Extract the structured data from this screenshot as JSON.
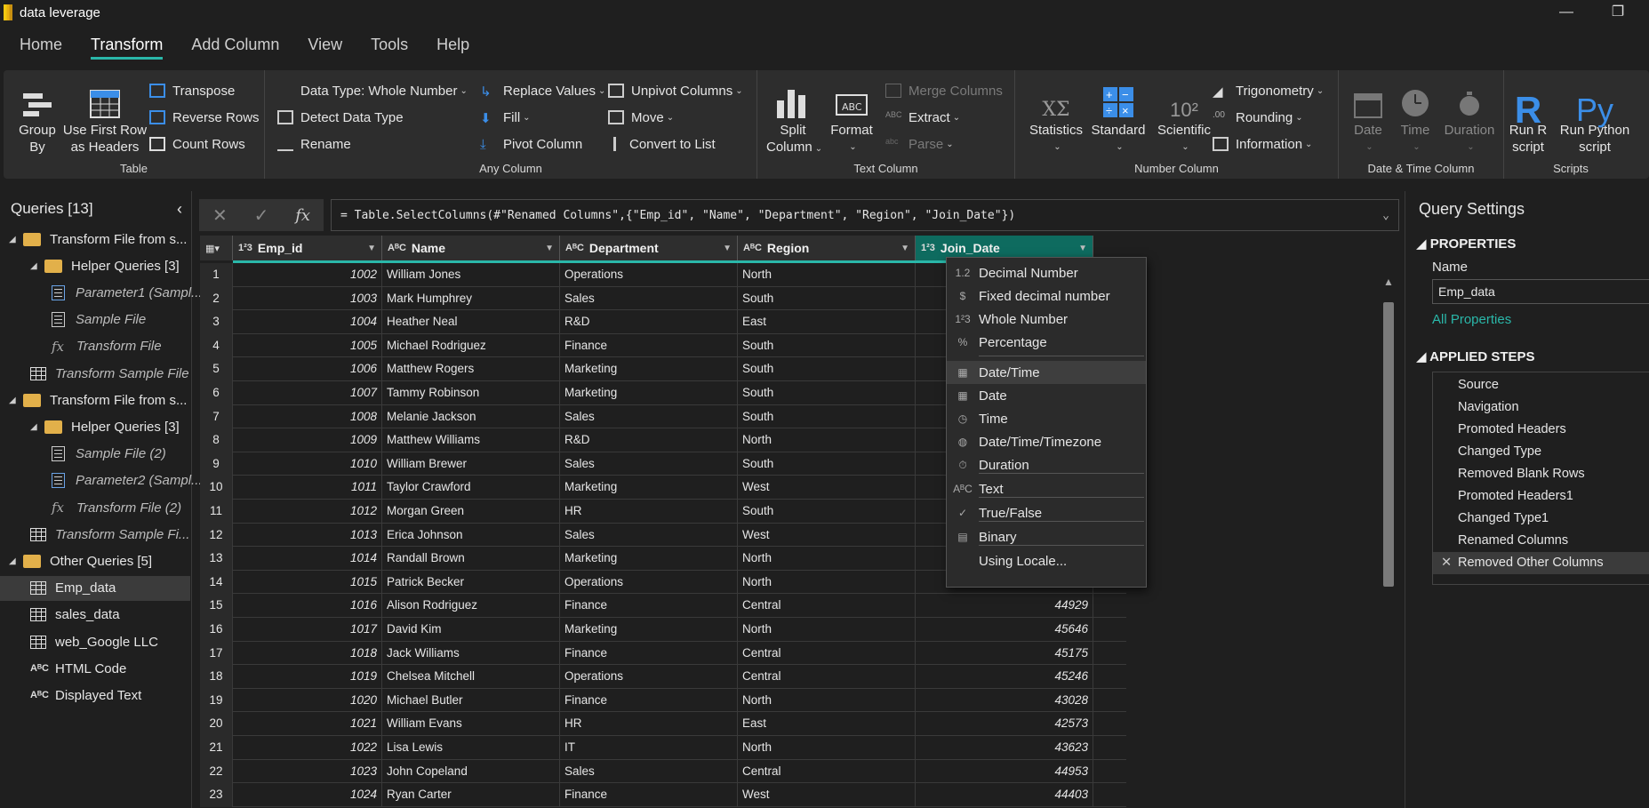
{
  "window": {
    "title": "data leverage",
    "minimize": "—",
    "restore": "❐"
  },
  "menu": {
    "items": [
      "Home",
      "Transform",
      "Add Column",
      "View",
      "Tools",
      "Help"
    ],
    "active": "Transform"
  },
  "ribbon": {
    "table": {
      "label": "Table",
      "group_by": [
        "Group",
        "By"
      ],
      "first_row": [
        "Use First Row",
        "as Headers"
      ],
      "transpose": "Transpose",
      "reverse_rows": "Reverse Rows",
      "count_rows": "Count Rows"
    },
    "any_column": {
      "label": "Any Column",
      "data_type": "Data Type: Whole Number",
      "detect_type": "Detect Data Type",
      "rename": "Rename",
      "replace_values": "Replace Values",
      "fill": "Fill",
      "pivot": "Pivot Column",
      "unpivot": "Unpivot Columns",
      "move": "Move",
      "convert_list": "Convert to List"
    },
    "text_column": {
      "label": "Text Column",
      "split": [
        "Split",
        "Column"
      ],
      "format": "Format",
      "merge": "Merge Columns",
      "extract": "Extract",
      "parse": "Parse"
    },
    "number_column": {
      "label": "Number Column",
      "statistics": "Statistics",
      "standard": "Standard",
      "scientific": "Scientific",
      "trig": "Trigonometry",
      "rounding": "Rounding",
      "information": "Information"
    },
    "datetime_column": {
      "label": "Date & Time Column",
      "date": "Date",
      "time": "Time",
      "duration": "Duration"
    },
    "scripts": {
      "label": "Scripts",
      "r": [
        "Run R",
        "script"
      ],
      "py": [
        "Run Python",
        "script"
      ]
    }
  },
  "queries": {
    "title": "Queries [13]",
    "items": [
      {
        "label": "Transform File from s...",
        "type": "folder",
        "indent": 0
      },
      {
        "label": "Helper Queries [3]",
        "type": "folder",
        "indent": 1
      },
      {
        "label": "Parameter1 (Sampl...",
        "type": "param",
        "indent": 2,
        "italic": true
      },
      {
        "label": "Sample File",
        "type": "doc",
        "indent": 2,
        "italic": true
      },
      {
        "label": "Transform File",
        "type": "fx",
        "indent": 2,
        "italic": true
      },
      {
        "label": "Transform Sample File",
        "type": "table",
        "indent": 1,
        "italic": true
      },
      {
        "label": "Transform File from s...",
        "type": "folder",
        "indent": 0
      },
      {
        "label": "Helper Queries [3]",
        "type": "folder",
        "indent": 1
      },
      {
        "label": "Sample File (2)",
        "type": "doc",
        "indent": 2,
        "italic": true
      },
      {
        "label": "Parameter2 (Sampl...",
        "type": "param",
        "indent": 2,
        "italic": true
      },
      {
        "label": "Transform File (2)",
        "type": "fx",
        "indent": 2,
        "italic": true
      },
      {
        "label": "Transform Sample Fi...",
        "type": "table",
        "indent": 1,
        "italic": true
      },
      {
        "label": "Other Queries [5]",
        "type": "folder",
        "indent": 0
      },
      {
        "label": "Emp_data",
        "type": "table",
        "indent": 1,
        "selected": true
      },
      {
        "label": "sales_data",
        "type": "table",
        "indent": 1
      },
      {
        "label": "web_Google LLC",
        "type": "table",
        "indent": 1
      },
      {
        "label": "HTML Code",
        "type": "abc",
        "indent": 1
      },
      {
        "label": "Displayed Text",
        "type": "abc",
        "indent": 1
      }
    ]
  },
  "formula": {
    "text": "= Table.SelectColumns(#\"Renamed Columns\",{\"Emp_id\", \"Name\", \"Department\", \"Region\", \"Join_Date\"})",
    "fx": "fx"
  },
  "table": {
    "columns": [
      {
        "name": "Emp_id",
        "type": "1²3"
      },
      {
        "name": "Name",
        "type": "AᴮC"
      },
      {
        "name": "Department",
        "type": "AᴮC"
      },
      {
        "name": "Region",
        "type": "AᴮC"
      },
      {
        "name": "Join_Date",
        "type": "1²3"
      }
    ],
    "rows": [
      [
        "1",
        "1002",
        "William Jones",
        "Operations",
        "North",
        ""
      ],
      [
        "2",
        "1003",
        "Mark Humphrey",
        "Sales",
        "South",
        ""
      ],
      [
        "3",
        "1004",
        "Heather Neal",
        "R&D",
        "East",
        ""
      ],
      [
        "4",
        "1005",
        "Michael Rodriguez",
        "Finance",
        "South",
        ""
      ],
      [
        "5",
        "1006",
        "Matthew Rogers",
        "Marketing",
        "South",
        ""
      ],
      [
        "6",
        "1007",
        "Tammy Robinson",
        "Marketing",
        "South",
        ""
      ],
      [
        "7",
        "1008",
        "Melanie Jackson",
        "Sales",
        "South",
        ""
      ],
      [
        "8",
        "1009",
        "Matthew Williams",
        "R&D",
        "North",
        ""
      ],
      [
        "9",
        "1010",
        "William Brewer",
        "Sales",
        "South",
        ""
      ],
      [
        "10",
        "1011",
        "Taylor Crawford",
        "Marketing",
        "West",
        ""
      ],
      [
        "11",
        "1012",
        "Morgan Green",
        "HR",
        "South",
        ""
      ],
      [
        "12",
        "1013",
        "Erica Johnson",
        "Sales",
        "West",
        ""
      ],
      [
        "13",
        "1014",
        "Randall Brown",
        "Marketing",
        "North",
        ""
      ],
      [
        "14",
        "1015",
        "Patrick Becker",
        "Operations",
        "North",
        ""
      ],
      [
        "15",
        "1016",
        "Alison Rodriguez",
        "Finance",
        "Central",
        "44929"
      ],
      [
        "16",
        "1017",
        "David Kim",
        "Marketing",
        "North",
        "45646"
      ],
      [
        "17",
        "1018",
        "Jack Williams",
        "Finance",
        "Central",
        "45175"
      ],
      [
        "18",
        "1019",
        "Chelsea Mitchell",
        "Operations",
        "Central",
        "45246"
      ],
      [
        "19",
        "1020",
        "Michael Butler",
        "Finance",
        "North",
        "43028"
      ],
      [
        "20",
        "1021",
        "William Evans",
        "HR",
        "East",
        "42573"
      ],
      [
        "21",
        "1022",
        "Lisa Lewis",
        "IT",
        "North",
        "43623"
      ],
      [
        "22",
        "1023",
        "John Copeland",
        "Sales",
        "Central",
        "44953"
      ],
      [
        "23",
        "1024",
        "Ryan Carter",
        "Finance",
        "West",
        "44403"
      ]
    ]
  },
  "type_menu": {
    "items": [
      {
        "label": "Decimal Number",
        "icon": "1.2"
      },
      {
        "label": "Fixed decimal number",
        "icon": "$"
      },
      {
        "label": "Whole Number",
        "icon": "1²3"
      },
      {
        "label": "Percentage",
        "icon": "%"
      },
      {
        "label": "Date/Time",
        "icon": "▦",
        "highlighted": true
      },
      {
        "label": "Date",
        "icon": "▦"
      },
      {
        "label": "Time",
        "icon": "◷"
      },
      {
        "label": "Date/Time/Timezone",
        "icon": "◍"
      },
      {
        "label": "Duration",
        "icon": "⏱"
      },
      {
        "label": "Text",
        "icon": "AᴮC"
      },
      {
        "label": "True/False",
        "icon": "✓"
      },
      {
        "label": "Binary",
        "icon": "▤"
      },
      {
        "label": "Using Locale...",
        "icon": ""
      }
    ]
  },
  "query_settings": {
    "title": "Query Settings",
    "properties": "PROPERTIES",
    "name_label": "Name",
    "name_value": "Emp_data",
    "all_props": "All Properties",
    "applied_steps": "APPLIED STEPS",
    "steps": [
      "Source",
      "Navigation",
      "Promoted Headers",
      "Changed Type",
      "Removed Blank Rows",
      "Promoted Headers1",
      "Changed Type1",
      "Renamed Columns",
      "Removed Other Columns"
    ],
    "selected_step": "Removed Other Columns"
  }
}
